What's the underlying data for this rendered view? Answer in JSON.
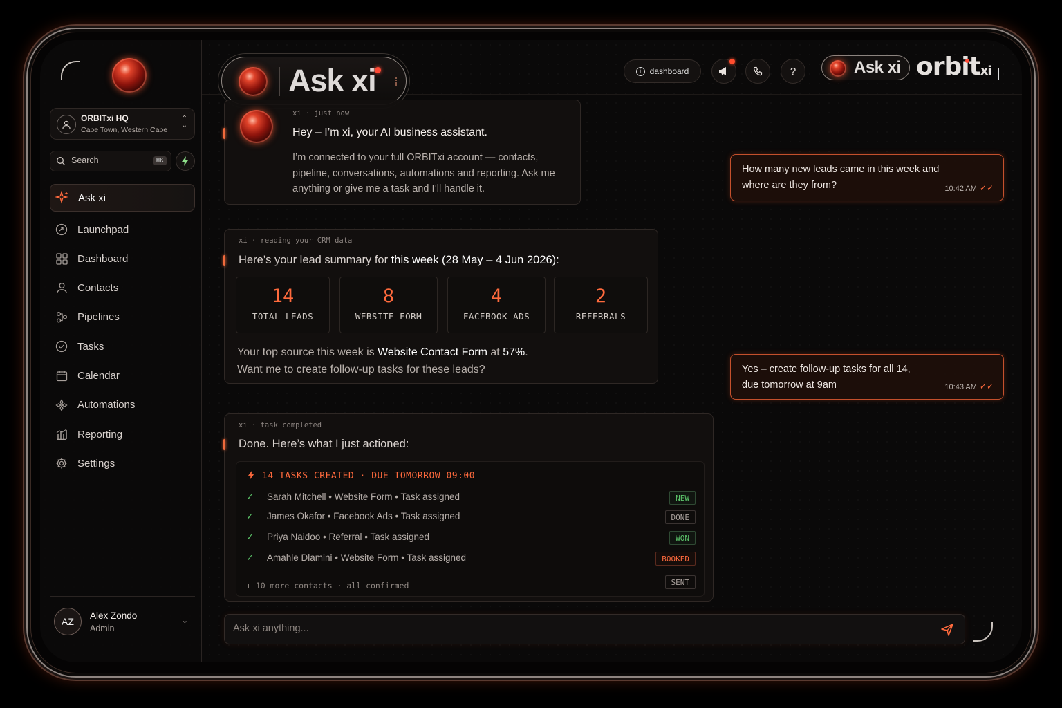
{
  "sidebar": {
    "org": {
      "name": "ORBITxi HQ",
      "location": "Cape Town, Western Cape"
    },
    "search": {
      "placeholder": "Search",
      "shortcut": "⌘K"
    },
    "items": [
      {
        "label": "Ask xi",
        "icon": "sparkle-icon",
        "active": true
      },
      {
        "label": "Launchpad",
        "icon": "rocket-icon"
      },
      {
        "label": "Dashboard",
        "icon": "grid-icon"
      },
      {
        "label": "Contacts",
        "icon": "person-icon"
      },
      {
        "label": "Pipelines",
        "icon": "pipeline-icon"
      },
      {
        "label": "Tasks",
        "icon": "check-circle-icon"
      },
      {
        "label": "Calendar",
        "icon": "calendar-icon"
      },
      {
        "label": "Automations",
        "icon": "automation-icon"
      },
      {
        "label": "Reporting",
        "icon": "bar-chart-icon"
      },
      {
        "label": "Settings",
        "icon": "gear-icon"
      }
    ],
    "user": {
      "initials": "AZ",
      "name": "Alex Zondo",
      "role": "Admin"
    }
  },
  "header": {
    "title": "Ask xi",
    "dashboard_label": "dashboard",
    "mini_title": "Ask xi",
    "brand": "orbit",
    "brand_suffix": "xi",
    "accent_color": "#ff6a3d"
  },
  "messages": {
    "intro": {
      "meta": "xi · just now",
      "greeting": "Hey – I’m xi, your AI business assistant.",
      "body": "I’m connected to your full ORBITxi account — contacts, pipeline, conversations, automations and reporting. Ask me anything or give me a task and I’ll handle it."
    },
    "user_q1": {
      "text": "How many new leads came in this week and where are they from?",
      "time": "10:42 AM"
    },
    "summary": {
      "meta": "xi · reading your CRM data",
      "lead_prefix": "Here’s your lead summary for ",
      "lead_bold": "this week (28 May – 4 Jun 2026):",
      "stats": [
        {
          "value": "14",
          "label": "TOTAL LEADS"
        },
        {
          "value": "8",
          "label": "WEBSITE FORM"
        },
        {
          "value": "4",
          "label": "FACEBOOK ADS"
        },
        {
          "value": "2",
          "label": "REFERRALS"
        }
      ],
      "top_prefix": "Your top source this week is ",
      "top_source": "Website Contact Form",
      "top_mid": " at ",
      "top_pct": "57%",
      "top_end": ".",
      "question": "Want me to create follow-up tasks for these leads?"
    },
    "user_q2": {
      "line1": "Yes – create follow-up tasks for all 14,",
      "line2": "due tomorrow at 9am",
      "time": "10:43 AM"
    },
    "tasks": {
      "meta": "xi · task completed",
      "title": "Done. Here’s what I just actioned:",
      "heading": "14 TASKS CREATED · DUE TOMORROW 09:00",
      "rows": [
        {
          "text": "Sarah Mitchell • Website Form • Task assigned",
          "tag": "NEW"
        },
        {
          "text": "James Okafor • Facebook Ads • Task assigned",
          "tag": "DONE"
        },
        {
          "text": "Priya Naidoo • Referral • Task assigned",
          "tag": "WON"
        },
        {
          "text": "Amahle Dlamini • Website Form • Task assigned",
          "tag": "BOOKED"
        }
      ],
      "more": "+ 10 more contacts · all confirmed",
      "last_tag": "SENT"
    }
  },
  "composer": {
    "placeholder": "Ask xi anything..."
  }
}
